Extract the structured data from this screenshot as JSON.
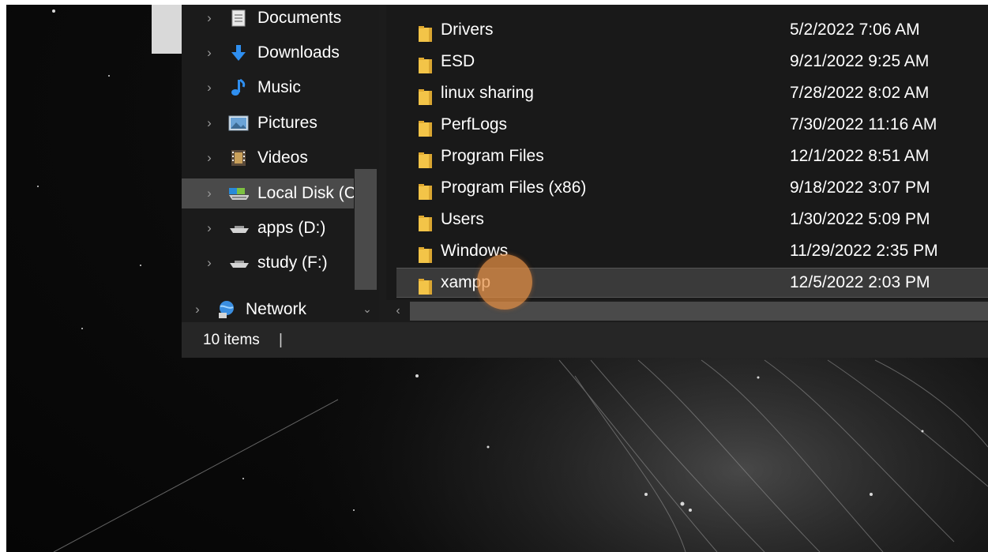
{
  "navigation_pane": {
    "items": [
      {
        "label": "Documents",
        "icon": "documents-icon"
      },
      {
        "label": "Downloads",
        "icon": "downloads-icon"
      },
      {
        "label": "Music",
        "icon": "music-icon"
      },
      {
        "label": "Pictures",
        "icon": "pictures-icon"
      },
      {
        "label": "Videos",
        "icon": "videos-icon"
      },
      {
        "label": "Local Disk (C",
        "icon": "local-disk-icon",
        "selected": true
      },
      {
        "label": "apps (D:)",
        "icon": "drive-icon"
      },
      {
        "label": "study (F:)",
        "icon": "drive-icon"
      },
      {
        "label": "Network",
        "icon": "network-icon"
      }
    ],
    "chevron": "›",
    "scroll_down_glyph": "⌄"
  },
  "file_list": {
    "rows": [
      {
        "name": "Drivers",
        "date_modified": "5/2/2022 7:06 AM"
      },
      {
        "name": "ESD",
        "date_modified": "9/21/2022 9:25 AM"
      },
      {
        "name": "linux sharing",
        "date_modified": "7/28/2022 8:02 AM"
      },
      {
        "name": "PerfLogs",
        "date_modified": "7/30/2022 11:16 AM"
      },
      {
        "name": "Program Files",
        "date_modified": "12/1/2022 8:51 AM"
      },
      {
        "name": "Program Files (x86)",
        "date_modified": "9/18/2022 3:07 PM"
      },
      {
        "name": "Users",
        "date_modified": "1/30/2022 5:09 PM"
      },
      {
        "name": "Windows",
        "date_modified": "11/29/2022 2:35 PM"
      },
      {
        "name": "xampp",
        "date_modified": "12/5/2022 2:03 PM",
        "selected": true
      }
    ],
    "scroll_left_glyph": "‹"
  },
  "status_bar": {
    "item_count": "10 items",
    "separator": "|"
  },
  "colors": {
    "folder": "#f3c448",
    "selection": "#4a4a4a",
    "click_indicator": "#e89044"
  }
}
